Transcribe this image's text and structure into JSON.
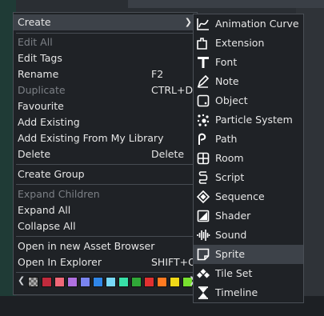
{
  "main_menu": {
    "items": [
      {
        "label": "Create",
        "shortcut": "",
        "submenu": true,
        "disabled": false,
        "highlighted": true
      },
      {
        "label": "Edit All",
        "shortcut": "",
        "disabled": true
      },
      {
        "label": "Edit Tags",
        "shortcut": "",
        "disabled": false
      },
      {
        "label": "Rename",
        "shortcut": "F2",
        "disabled": false
      },
      {
        "label": "Duplicate",
        "shortcut": "CTRL+D",
        "disabled": true
      },
      {
        "label": "Favourite",
        "shortcut": "",
        "disabled": false
      },
      {
        "label": "Add Existing",
        "shortcut": "",
        "disabled": false
      },
      {
        "label": "Add Existing From My Library",
        "shortcut": "",
        "disabled": false
      },
      {
        "label": "Delete",
        "shortcut": "Delete",
        "disabled": false
      },
      {
        "label": "Create Group",
        "shortcut": "",
        "disabled": false
      },
      {
        "label": "Expand Children",
        "shortcut": "",
        "disabled": true
      },
      {
        "label": "Expand All",
        "shortcut": "",
        "disabled": false
      },
      {
        "label": "Collapse All",
        "shortcut": "",
        "disabled": false
      },
      {
        "label": "Open in new Asset Browser",
        "shortcut": "",
        "disabled": false
      },
      {
        "label": "Open In Explorer",
        "shortcut": "SHIFT+O",
        "disabled": false
      }
    ],
    "color_swatches": [
      "#c02a3c",
      "#f06878",
      "#b070e0",
      "#7a84f0",
      "#2f86e8",
      "#78d8f8",
      "#38e0a8",
      "#30a838",
      "#e03030",
      "#ff7a20",
      "#f0d818",
      "#78e030"
    ]
  },
  "submenu": {
    "items": [
      {
        "label": "Animation Curve",
        "icon": "animation-curve-icon"
      },
      {
        "label": "Extension",
        "icon": "extension-icon"
      },
      {
        "label": "Font",
        "icon": "font-icon"
      },
      {
        "label": "Note",
        "icon": "note-icon"
      },
      {
        "label": "Object",
        "icon": "object-icon"
      },
      {
        "label": "Particle System",
        "icon": "particle-system-icon"
      },
      {
        "label": "Path",
        "icon": "path-icon"
      },
      {
        "label": "Room",
        "icon": "room-icon"
      },
      {
        "label": "Script",
        "icon": "script-icon"
      },
      {
        "label": "Sequence",
        "icon": "sequence-icon"
      },
      {
        "label": "Shader",
        "icon": "shader-icon"
      },
      {
        "label": "Sound",
        "icon": "sound-icon"
      },
      {
        "label": "Sprite",
        "icon": "sprite-icon",
        "highlighted": true
      },
      {
        "label": "Tile Set",
        "icon": "tile-set-icon"
      },
      {
        "label": "Timeline",
        "icon": "timeline-icon"
      }
    ]
  }
}
